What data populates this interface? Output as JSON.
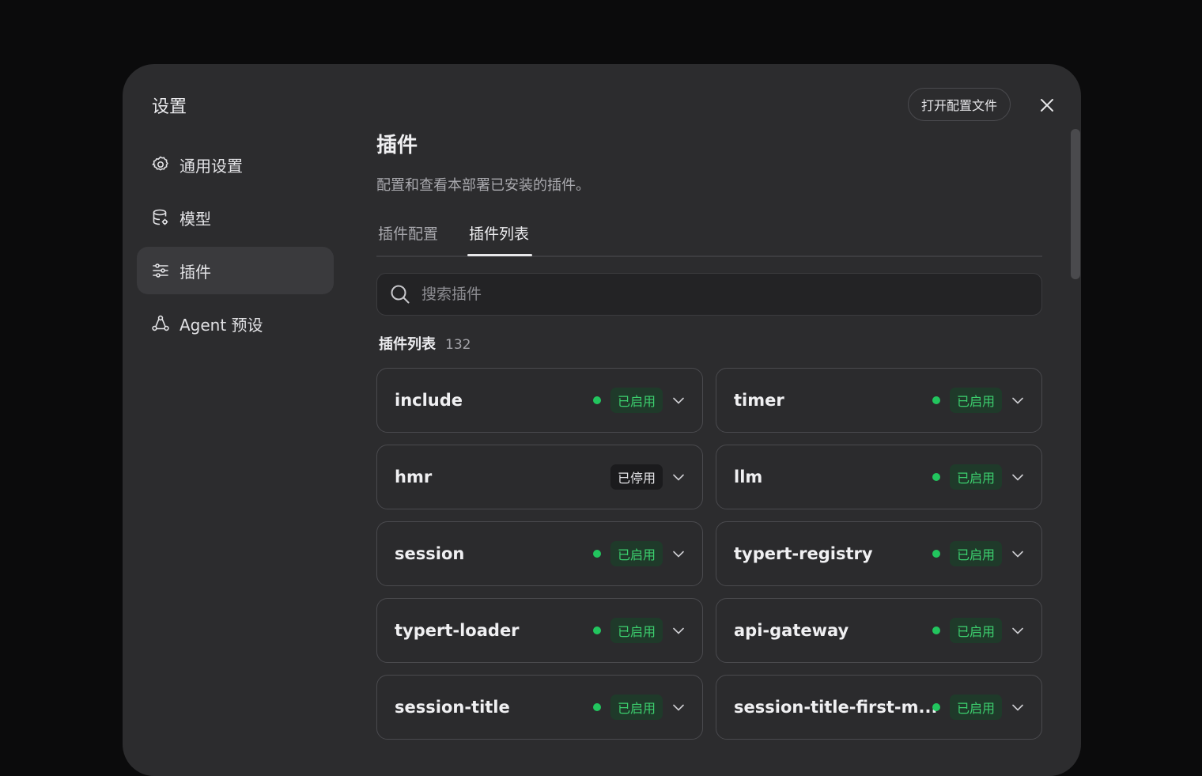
{
  "modal": {
    "title": "设置",
    "open_config_label": "打开配置文件"
  },
  "nav": {
    "items": [
      {
        "label": "通用设置",
        "icon": "gear-icon"
      },
      {
        "label": "模型",
        "icon": "database-icon"
      },
      {
        "label": "插件",
        "icon": "sliders-icon",
        "active": true
      },
      {
        "label": "Agent 预设",
        "icon": "agent-icon"
      }
    ]
  },
  "page": {
    "title": "插件",
    "description": "配置和查看本部署已安装的插件。",
    "tabs": [
      {
        "label": "插件配置"
      },
      {
        "label": "插件列表",
        "active": true
      }
    ],
    "search": {
      "placeholder": "搜索插件",
      "value": ""
    },
    "list_title": "插件列表",
    "list_count": "132"
  },
  "status_labels": {
    "enabled": "已启用",
    "disabled": "已停用"
  },
  "colors": {
    "enabled": "#22c55e",
    "accent_bg": "#3a3a3d"
  },
  "plugins": [
    {
      "name": "include",
      "status": "已启用"
    },
    {
      "name": "timer",
      "status": "已启用"
    },
    {
      "name": "hmr",
      "status": "已停用"
    },
    {
      "name": "llm",
      "status": "已启用"
    },
    {
      "name": "session",
      "status": "已启用"
    },
    {
      "name": "typert-registry",
      "status": "已启用"
    },
    {
      "name": "typert-loader",
      "status": "已启用"
    },
    {
      "name": "api-gateway",
      "status": "已启用"
    },
    {
      "name": "session-title",
      "status": "已启用"
    },
    {
      "name": "session-title-first-m...",
      "status": "已启用"
    }
  ]
}
